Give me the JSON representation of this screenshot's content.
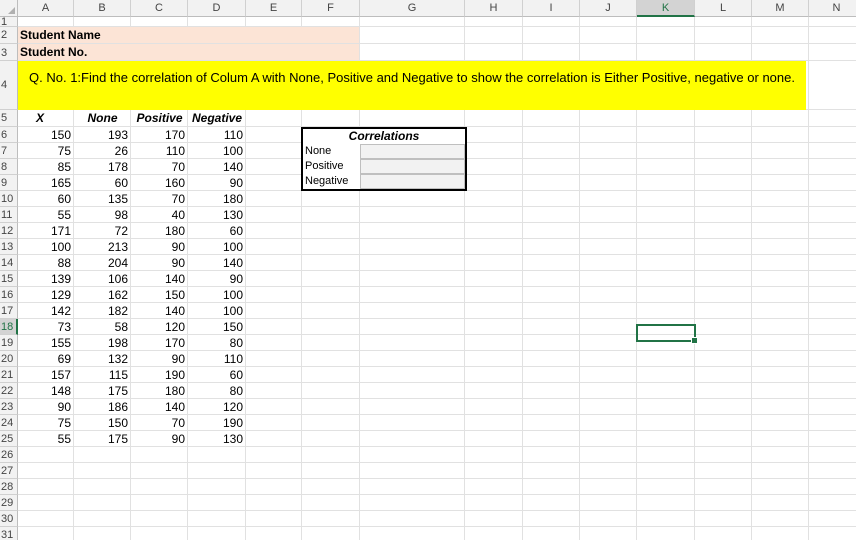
{
  "columns": [
    "A",
    "B",
    "C",
    "D",
    "E",
    "F",
    "G",
    "H",
    "I",
    "J",
    "K",
    "L",
    "M",
    "N"
  ],
  "selected_column": "K",
  "rows": [
    "1",
    "2",
    "3",
    "4",
    "5",
    "6",
    "7",
    "8",
    "9",
    "10",
    "11",
    "12",
    "13",
    "14",
    "15",
    "16",
    "17",
    "18",
    "19",
    "20",
    "21",
    "22",
    "23",
    "24",
    "25",
    "26",
    "27",
    "28",
    "29",
    "30",
    "31"
  ],
  "selected_row": "18",
  "student": {
    "name_label": "Student Name",
    "number_label": "Student No."
  },
  "question": "Q. No. 1:Find the correlation of Colum A with None, Positive and Negative to show the correlation is Either Positive, negative or none.",
  "table": {
    "headers": [
      "X",
      "None",
      "Positive",
      "Negative"
    ],
    "data": [
      [
        150,
        193,
        170,
        110
      ],
      [
        75,
        26,
        110,
        100
      ],
      [
        85,
        178,
        70,
        140
      ],
      [
        165,
        60,
        160,
        90
      ],
      [
        60,
        135,
        70,
        180
      ],
      [
        55,
        98,
        40,
        130
      ],
      [
        171,
        72,
        180,
        60
      ],
      [
        100,
        213,
        90,
        100
      ],
      [
        88,
        204,
        90,
        140
      ],
      [
        139,
        106,
        140,
        90
      ],
      [
        129,
        162,
        150,
        100
      ],
      [
        142,
        182,
        140,
        100
      ],
      [
        73,
        58,
        120,
        150
      ],
      [
        155,
        198,
        170,
        80
      ],
      [
        69,
        132,
        90,
        110
      ],
      [
        157,
        115,
        190,
        60
      ],
      [
        148,
        175,
        180,
        80
      ],
      [
        90,
        186,
        140,
        120
      ],
      [
        75,
        150,
        70,
        190
      ],
      [
        55,
        175,
        90,
        130
      ]
    ]
  },
  "correlations": {
    "title": "Correlations",
    "labels": [
      "None",
      "Positive",
      "Negative"
    ]
  },
  "colors": {
    "accent": "#217346",
    "pink": "#fce4d6",
    "yellow": "#ffff00"
  }
}
